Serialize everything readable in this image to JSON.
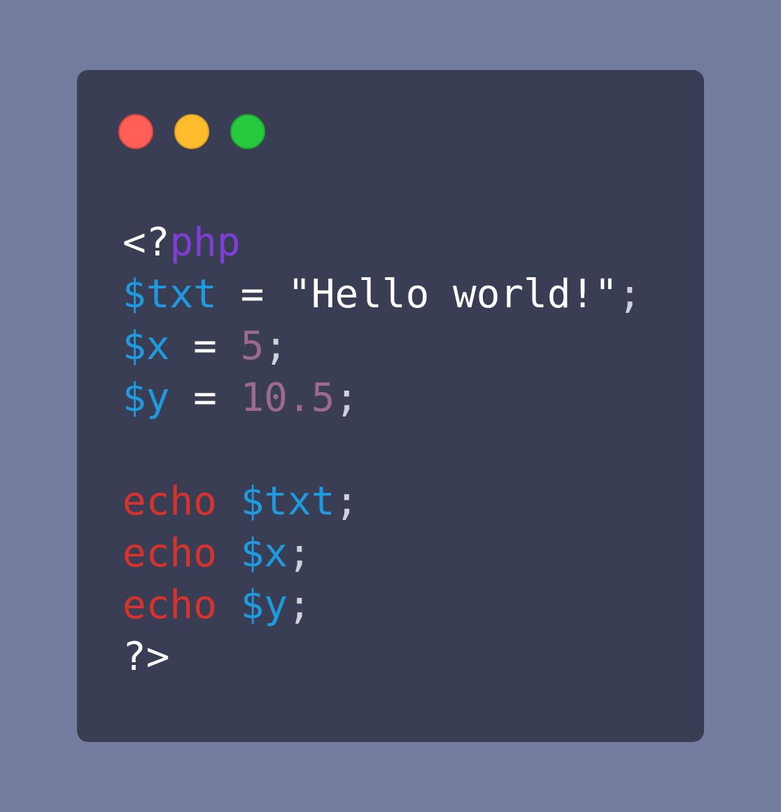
{
  "window": {
    "controls": [
      {
        "name": "close",
        "color": "#ff5f56"
      },
      {
        "name": "minimize",
        "color": "#ffbd2e"
      },
      {
        "name": "maximize",
        "color": "#27c93f"
      }
    ]
  },
  "code": {
    "language": "php",
    "lines": [
      [
        {
          "text": "<?",
          "type": "plain"
        },
        {
          "text": "php",
          "type": "kw"
        }
      ],
      [
        {
          "text": "$txt",
          "type": "var"
        },
        {
          "text": " = ",
          "type": "plain"
        },
        {
          "text": "\"Hello world!\"",
          "type": "plain"
        },
        {
          "text": ";",
          "type": "punct"
        }
      ],
      [
        {
          "text": "$x",
          "type": "var"
        },
        {
          "text": " = ",
          "type": "plain"
        },
        {
          "text": "5",
          "type": "num"
        },
        {
          "text": ";",
          "type": "punct"
        }
      ],
      [
        {
          "text": "$y",
          "type": "var"
        },
        {
          "text": " = ",
          "type": "plain"
        },
        {
          "text": "10.5",
          "type": "num"
        },
        {
          "text": ";",
          "type": "punct"
        }
      ],
      [],
      [
        {
          "text": "echo",
          "type": "echo"
        },
        {
          "text": " ",
          "type": "plain"
        },
        {
          "text": "$txt",
          "type": "var"
        },
        {
          "text": ";",
          "type": "punct"
        }
      ],
      [
        {
          "text": "echo",
          "type": "echo"
        },
        {
          "text": " ",
          "type": "plain"
        },
        {
          "text": "$x",
          "type": "var"
        },
        {
          "text": ";",
          "type": "punct"
        }
      ],
      [
        {
          "text": "echo",
          "type": "echo"
        },
        {
          "text": " ",
          "type": "plain"
        },
        {
          "text": "$y",
          "type": "var"
        },
        {
          "text": ";",
          "type": "punct"
        }
      ],
      [
        {
          "text": "?>",
          "type": "plain"
        }
      ]
    ]
  },
  "colors": {
    "page_background": "#737b9e",
    "window_background": "#3a3e54",
    "plain": "#ffffff",
    "keyword": "#7f3fd6",
    "variable": "#1e9be0",
    "number": "#9d6a8e",
    "echo": "#d8322d",
    "punctuation": "#cfd2dc"
  }
}
